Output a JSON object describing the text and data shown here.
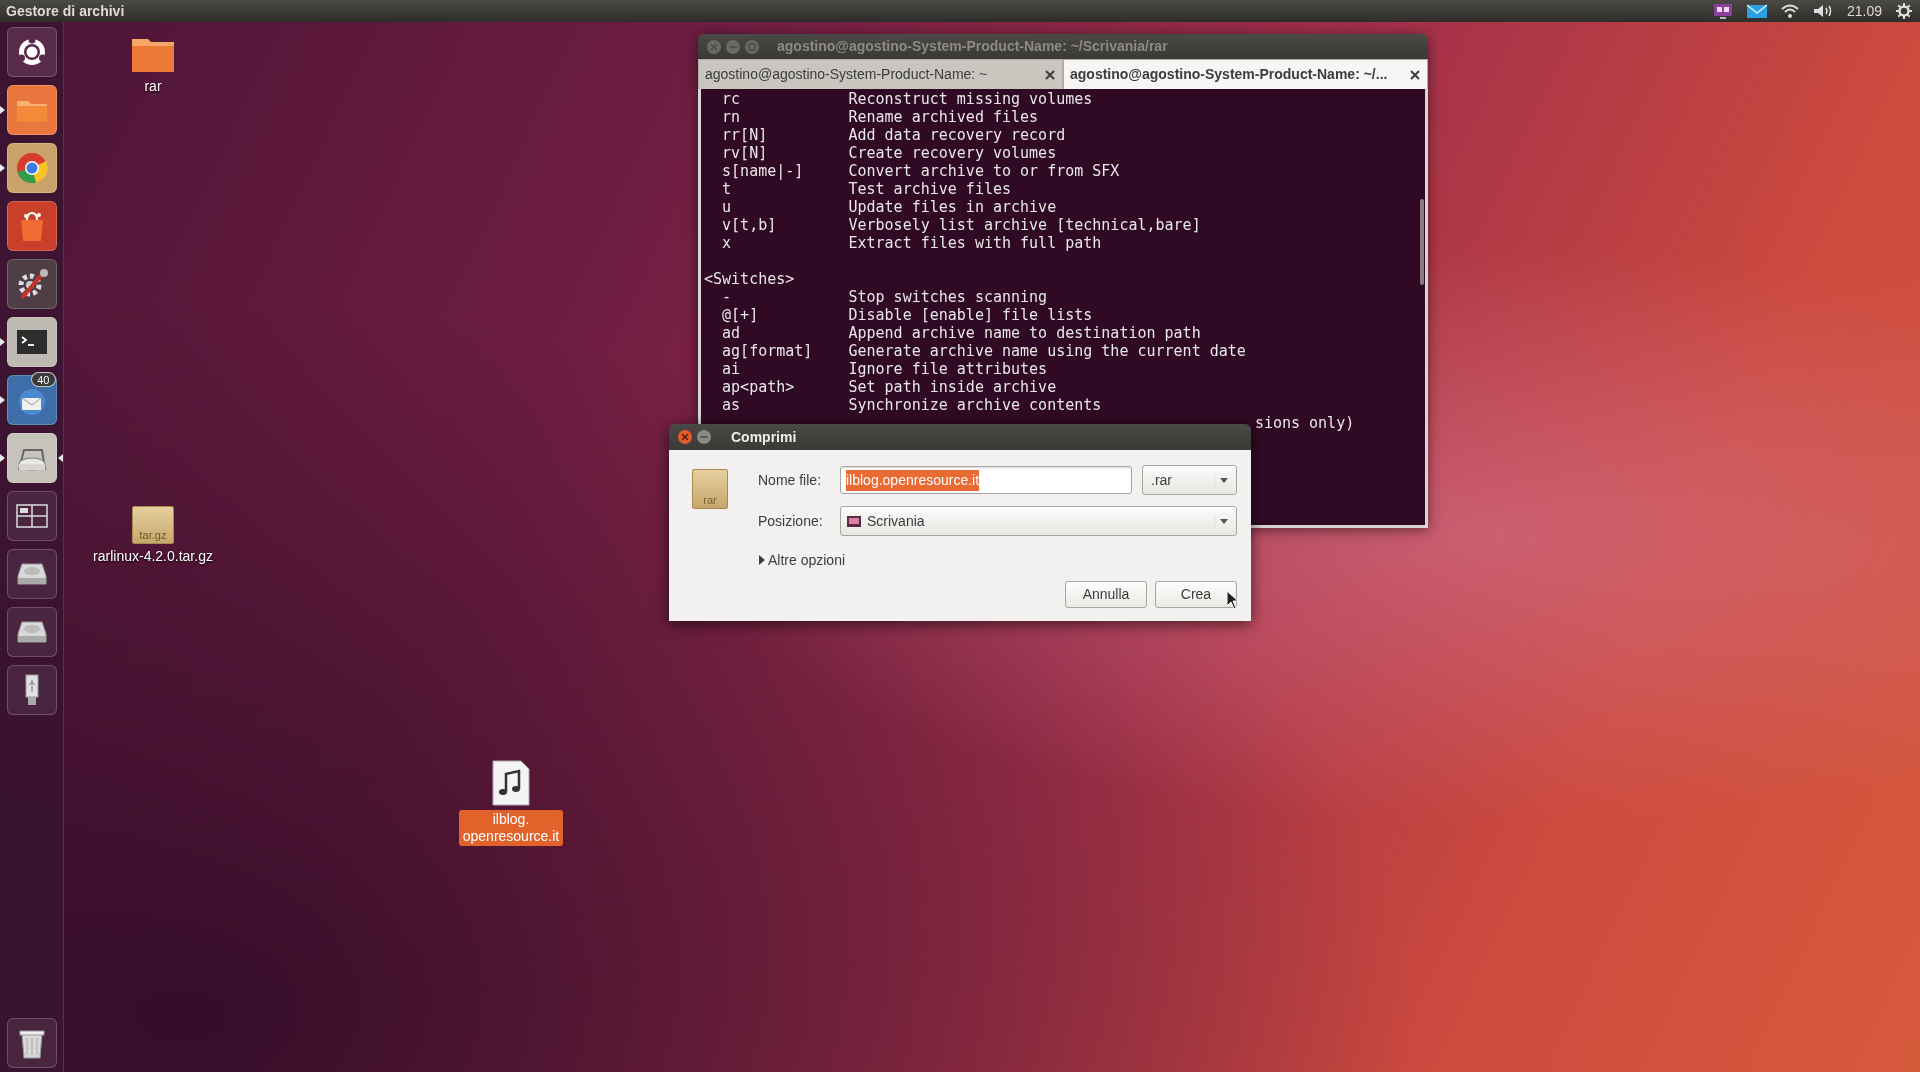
{
  "top_panel": {
    "app_title": "Gestore di archivi",
    "clock": "21.09"
  },
  "launcher": {
    "items": [
      {
        "kind": "dash",
        "running": false,
        "focused": false
      },
      {
        "kind": "files",
        "running": true,
        "focused": false
      },
      {
        "kind": "browser",
        "running": true,
        "focused": false
      },
      {
        "kind": "store",
        "running": false,
        "focused": false
      },
      {
        "kind": "settings",
        "running": false,
        "focused": false
      },
      {
        "kind": "terminal",
        "running": true,
        "focused": false
      },
      {
        "kind": "mail",
        "running": true,
        "focused": false,
        "badge": "40"
      },
      {
        "kind": "archiver",
        "running": true,
        "focused": true
      },
      {
        "kind": "workspaces",
        "running": false,
        "focused": false
      },
      {
        "kind": "drive",
        "running": false,
        "focused": false
      },
      {
        "kind": "drive",
        "running": false,
        "focused": false
      },
      {
        "kind": "usb",
        "running": false,
        "focused": false
      },
      {
        "kind": "trash",
        "running": false,
        "focused": false
      }
    ]
  },
  "desktop_icons": [
    {
      "kind": "folder",
      "label_lines": [
        "rar"
      ],
      "selected": false
    },
    {
      "kind": "archive",
      "icon_text": "tar.gz",
      "label_lines": [
        "rarlinux-4.2.0.tar.gz"
      ],
      "selected": false
    },
    {
      "kind": "audio",
      "label_lines": [
        "ilblog.",
        "openresource.it"
      ],
      "selected": true
    }
  ],
  "terminal": {
    "title": "agostino@agostino-System-Product-Name: ~/Scrivania/rar",
    "tabs": [
      {
        "label": "agostino@agostino-System-Product-Name: ~",
        "selected": false
      },
      {
        "label": "agostino@agostino-System-Product-Name: ~/...",
        "selected": true
      }
    ],
    "lines": [
      {
        "kind": "row",
        "command": "rc",
        "description": "Reconstruct missing volumes"
      },
      {
        "kind": "row",
        "command": "rn",
        "description": "Rename archived files"
      },
      {
        "kind": "row",
        "command": "rr[N]",
        "description": "Add data recovery record"
      },
      {
        "kind": "row",
        "command": "rv[N]",
        "description": "Create recovery volumes"
      },
      {
        "kind": "row",
        "command": "s[name|-]",
        "description": "Convert archive to or from SFX"
      },
      {
        "kind": "row",
        "command": "t",
        "description": "Test archive files"
      },
      {
        "kind": "row",
        "command": "u",
        "description": "Update files in archive"
      },
      {
        "kind": "row",
        "command": "v[t,b]",
        "description": "Verbosely list archive [technical,bare]"
      },
      {
        "kind": "row",
        "command": "x",
        "description": "Extract files with full path"
      },
      {
        "kind": "blank"
      },
      {
        "kind": "heading",
        "text": "<Switches>"
      },
      {
        "kind": "row",
        "command": "-",
        "description": "Stop switches scanning"
      },
      {
        "kind": "row",
        "command": "@[+]",
        "description": "Disable [enable] file lists"
      },
      {
        "kind": "row",
        "command": "ad",
        "description": "Append archive name to destination path"
      },
      {
        "kind": "row",
        "command": "ag[format]",
        "description": "Generate archive name using the current date"
      },
      {
        "kind": "row",
        "command": "ai",
        "description": "Ignore file attributes"
      },
      {
        "kind": "row",
        "command": "ap<path>",
        "description": "Set path inside archive"
      },
      {
        "kind": "row",
        "command": "as",
        "description": "Synchronize archive contents"
      },
      {
        "kind": "cut",
        "description": "sions only)"
      }
    ]
  },
  "dialog": {
    "title": "Comprimi",
    "icon_label": "rar",
    "name_label": "Nome file:",
    "name_value": "ilblog.openresource.it",
    "name_selected": true,
    "extension": ".rar",
    "location_label": "Posizione:",
    "location": "Scrivania",
    "expander": {
      "label": "Altre opzioni",
      "expanded": false
    },
    "buttons": [
      "Annulla",
      "Crea"
    ]
  }
}
